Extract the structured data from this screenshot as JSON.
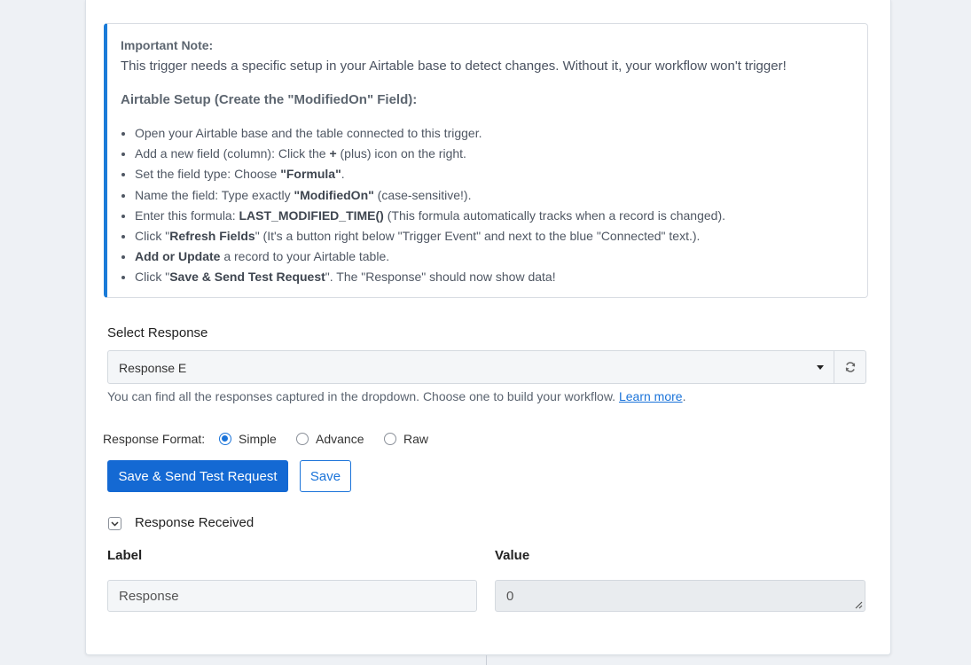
{
  "note": {
    "title": "Important Note:",
    "text": "This trigger needs a specific setup in your Airtable base to detect changes. Without it, your workflow won't trigger!",
    "heading": "Airtable Setup (Create the \"ModifiedOn\" Field):",
    "steps": [
      {
        "pre": "Open your Airtable base and the table connected to this trigger.",
        "bold": "",
        "post": ""
      },
      {
        "pre": "Add a new field (column): Click the ",
        "bold": "+",
        "post": " (plus) icon on the right."
      },
      {
        "pre": "Set the field type: Choose ",
        "bold": "\"Formula\"",
        "post": "."
      },
      {
        "pre": "Name the field: Type exactly ",
        "bold": "\"ModifiedOn\"",
        "post": " (case-sensitive!)."
      },
      {
        "pre": "Enter this formula: ",
        "bold": "LAST_MODIFIED_TIME()",
        "post": " (This formula automatically tracks when a record is changed)."
      },
      {
        "pre": "Click \"",
        "bold": "Refresh Fields",
        "post": "\" (It's a button right below \"Trigger Event\" and next to the blue \"Connected\" text.)."
      },
      {
        "pre": "",
        "bold": "Add or Update",
        "post": " a record to your Airtable table."
      },
      {
        "pre": "Click \"",
        "bold": "Save & Send Test Request",
        "post": "\". The \"Response\" should now show data!"
      }
    ]
  },
  "select_response": {
    "label": "Select Response",
    "value": "Response E",
    "help_text": "You can find all the responses captured in the dropdown. Choose one to build your workflow. ",
    "learn_more": "Learn more",
    "help_end": "."
  },
  "response_format": {
    "label": "Response Format:",
    "options": [
      "Simple",
      "Advance",
      "Raw"
    ],
    "selected": "Simple"
  },
  "buttons": {
    "save_send": "Save & Send Test Request",
    "save": "Save"
  },
  "response_received": {
    "title": "Response Received",
    "label_header": "Label",
    "value_header": "Value",
    "label_value": "Response",
    "value_value": "0"
  },
  "colors": {
    "accent": "#1469d3",
    "note_border": "#1a7bd8"
  }
}
